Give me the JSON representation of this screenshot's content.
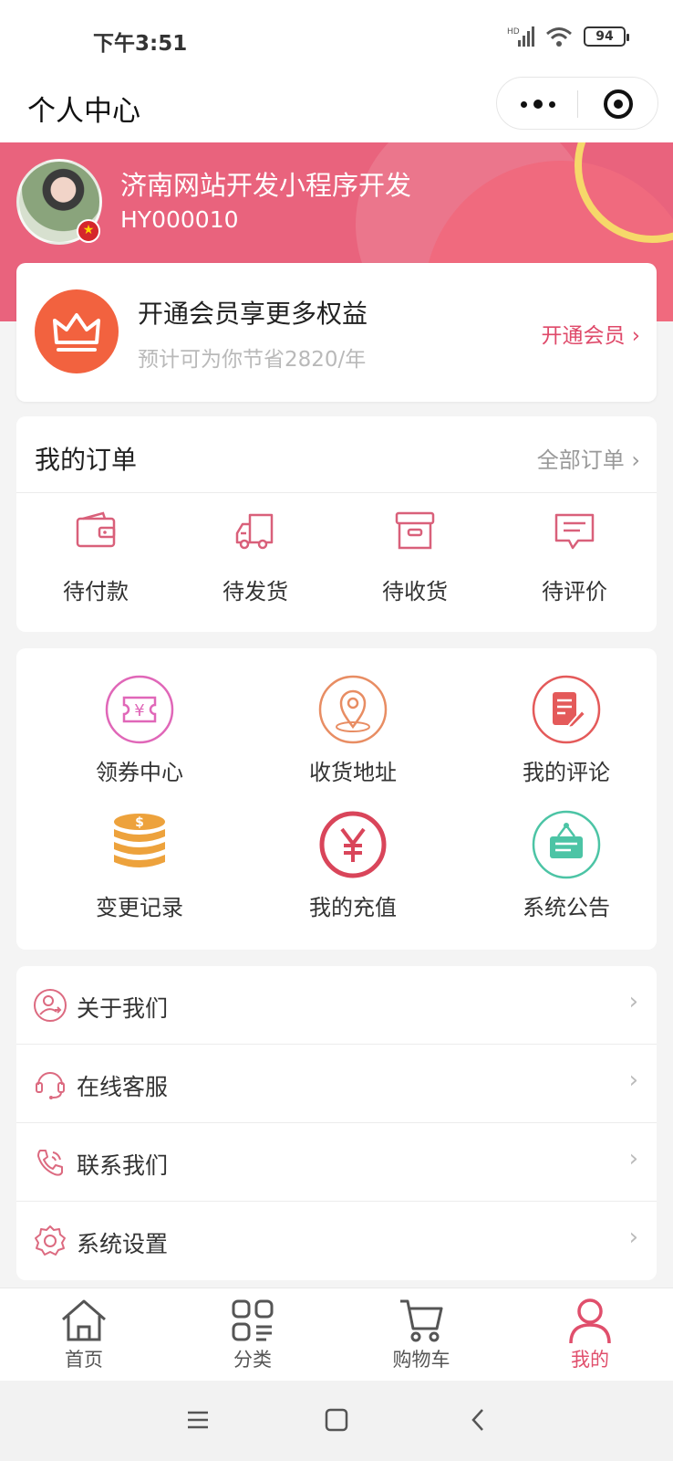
{
  "status_bar": {
    "time": "下午3:51",
    "battery": "94",
    "network": "HD"
  },
  "nav": {
    "title": "个人中心"
  },
  "profile": {
    "name": "济南网站开发小程序开发",
    "member_id": "HY000010"
  },
  "vip": {
    "title": "开通会员享更多权益",
    "subtitle": "预计可为你节省2820/年",
    "link_label": "开通会员 ›"
  },
  "orders": {
    "title": "我的订单",
    "all_label": "全部订单 ›",
    "items": [
      {
        "label": "待付款",
        "icon": "wallet-icon"
      },
      {
        "label": "待发货",
        "icon": "truck-icon"
      },
      {
        "label": "待收货",
        "icon": "box-icon"
      },
      {
        "label": "待评价",
        "icon": "comment-icon"
      }
    ]
  },
  "tools": [
    {
      "label": "领券中心",
      "icon": "coupon-icon",
      "color": "#e067b8"
    },
    {
      "label": "收货地址",
      "icon": "location-icon",
      "color": "#e88d63"
    },
    {
      "label": "我的评论",
      "icon": "edit-icon",
      "color": "#e45a5a"
    },
    {
      "label": "变更记录",
      "icon": "coins-icon",
      "color": "#eda23c"
    },
    {
      "label": "我的充值",
      "icon": "yuan-icon",
      "color": "#d9455a"
    },
    {
      "label": "系统公告",
      "icon": "notice-icon",
      "color": "#4cc4a5"
    }
  ],
  "menu": [
    {
      "label": "关于我们",
      "icon": "user-info-icon"
    },
    {
      "label": "在线客服",
      "icon": "headset-icon"
    },
    {
      "label": "联系我们",
      "icon": "phone-icon"
    },
    {
      "label": "系统设置",
      "icon": "settings-icon"
    }
  ],
  "tabs": [
    {
      "label": "首页",
      "icon": "home-icon",
      "active": false
    },
    {
      "label": "分类",
      "icon": "category-icon",
      "active": false
    },
    {
      "label": "购物车",
      "icon": "cart-icon",
      "active": false
    },
    {
      "label": "我的",
      "icon": "user-icon",
      "active": true
    }
  ],
  "colors": {
    "brand": "#e9637d",
    "accent": "#df4a6a",
    "crown": "#f2623f",
    "icon_pink": "#dc6a80"
  }
}
